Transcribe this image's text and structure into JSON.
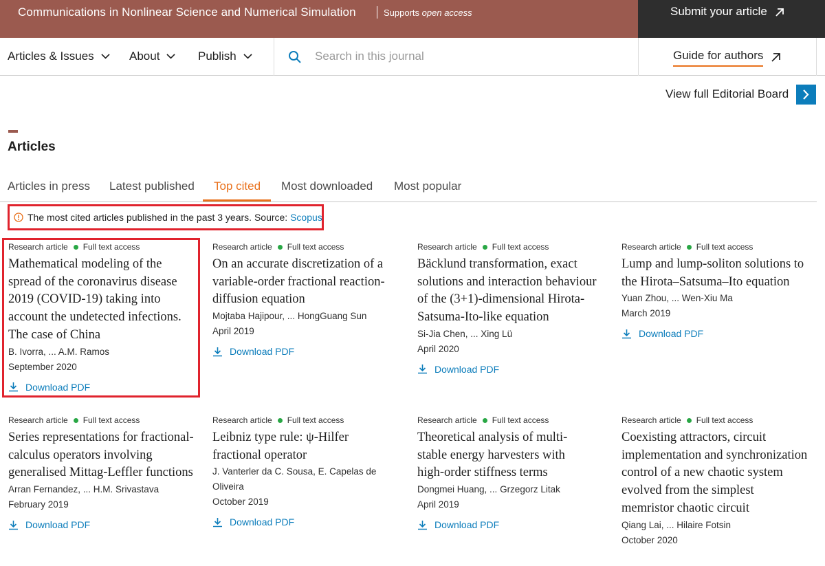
{
  "header": {
    "journal_title": "Communications in Nonlinear Science and Numerical Simulation",
    "supports_prefix": "Supports ",
    "supports_em": "open access",
    "submit_label": "Submit your article"
  },
  "nav": {
    "items": [
      {
        "label": "Articles & Issues"
      },
      {
        "label": "About"
      },
      {
        "label": "Publish"
      }
    ],
    "search_placeholder": "Search in this journal",
    "guide_label": "Guide for authors"
  },
  "editorial_label": "View full Editorial Board",
  "section_title": "Articles",
  "tabs": [
    {
      "label": "Articles in press"
    },
    {
      "label": "Latest published"
    },
    {
      "label": "Top cited"
    },
    {
      "label": "Most downloaded"
    },
    {
      "label": "Most popular"
    }
  ],
  "notice": {
    "text": "The most cited articles published in the past 3 years. Source: ",
    "link": "Scopus"
  },
  "articles": [
    {
      "type": "Research article",
      "access": "Full text access",
      "title": "Mathematical modeling of the spread of the coronavirus disease 2019 (COVID-19) taking into account the undetected infections. The case of China",
      "authors": "B. Ivorra, ... A.M. Ramos",
      "date": "September 2020",
      "pdf": "Download PDF"
    },
    {
      "type": "Research article",
      "access": "Full text access",
      "title": "On an accurate discretization of a variable-order fractional reaction-diffusion equation",
      "authors": "Mojtaba Hajipour, ... HongGuang Sun",
      "date": "April 2019",
      "pdf": "Download PDF"
    },
    {
      "type": "Research article",
      "access": "Full text access",
      "title": "Bäcklund transformation, exact solutions and interaction behaviour of the (3+1)-dimensional Hirota-Satsuma-Ito-like equation",
      "authors": "Si-Jia Chen, ... Xing Lü",
      "date": "April 2020",
      "pdf": "Download PDF"
    },
    {
      "type": "Research article",
      "access": "Full text access",
      "title": "Lump and lump-soliton solutions to the Hirota–Satsuma–Ito equation",
      "authors": "Yuan Zhou, ... Wen-Xiu Ma",
      "date": "March 2019",
      "pdf": "Download PDF"
    },
    {
      "type": "Research article",
      "access": "Full text access",
      "title": "Series representations for fractional-calculus operators involving generalised Mittag-Leffler functions",
      "authors": "Arran Fernandez, ... H.M. Srivastava",
      "date": "February 2019",
      "pdf": "Download PDF"
    },
    {
      "type": "Research article",
      "access": "Full text access",
      "title": "Leibniz type rule: ψ-Hilfer fractional operator",
      "authors": "J. Vanterler da C. Sousa, E. Capelas de Oliveira",
      "date": "October 2019",
      "pdf": "Download PDF"
    },
    {
      "type": "Research article",
      "access": "Full text access",
      "title": "Theoretical analysis of multi-stable energy harvesters with high-order stiffness terms",
      "authors": "Dongmei Huang, ... Grzegorz Litak",
      "date": "April 2019",
      "pdf": "Download PDF"
    },
    {
      "type": "Research article",
      "access": "Full text access",
      "title": "Coexisting attractors, circuit implementation and synchronization control of a new chaotic system evolved from the simplest memristor chaotic circuit",
      "authors": "Qiang Lai, ... Hilaire Fotsin",
      "date": "October 2020",
      "pdf": ""
    }
  ]
}
